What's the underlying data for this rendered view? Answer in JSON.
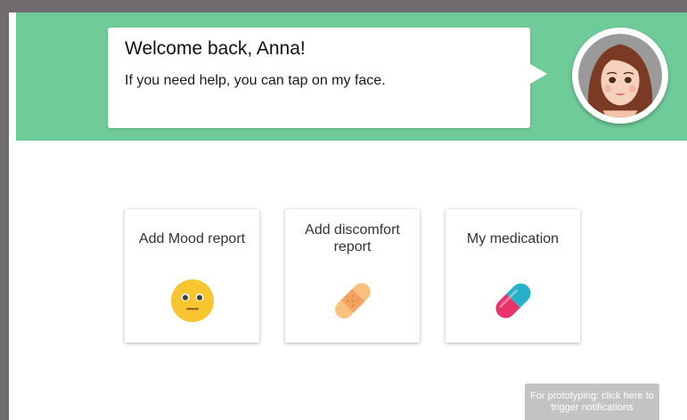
{
  "header": {
    "title": "Welcome back, Anna!",
    "subtitle": "If you need help, you can tap on my face."
  },
  "avatar": {
    "icon": "assistant-avatar-icon"
  },
  "cards": [
    {
      "label": "Add Mood report",
      "icon": "neutral-face-icon"
    },
    {
      "label": "Add discomfort report",
      "icon": "bandage-icon"
    },
    {
      "label": "My medication",
      "icon": "pill-icon"
    }
  ],
  "prototype_button": {
    "label": "For prototyping: click here to trigger notifications"
  },
  "colors": {
    "header_bg": "#6fcc99",
    "frame_border": "#6f6b6e",
    "prototype_bg": "#c3c3c3"
  }
}
